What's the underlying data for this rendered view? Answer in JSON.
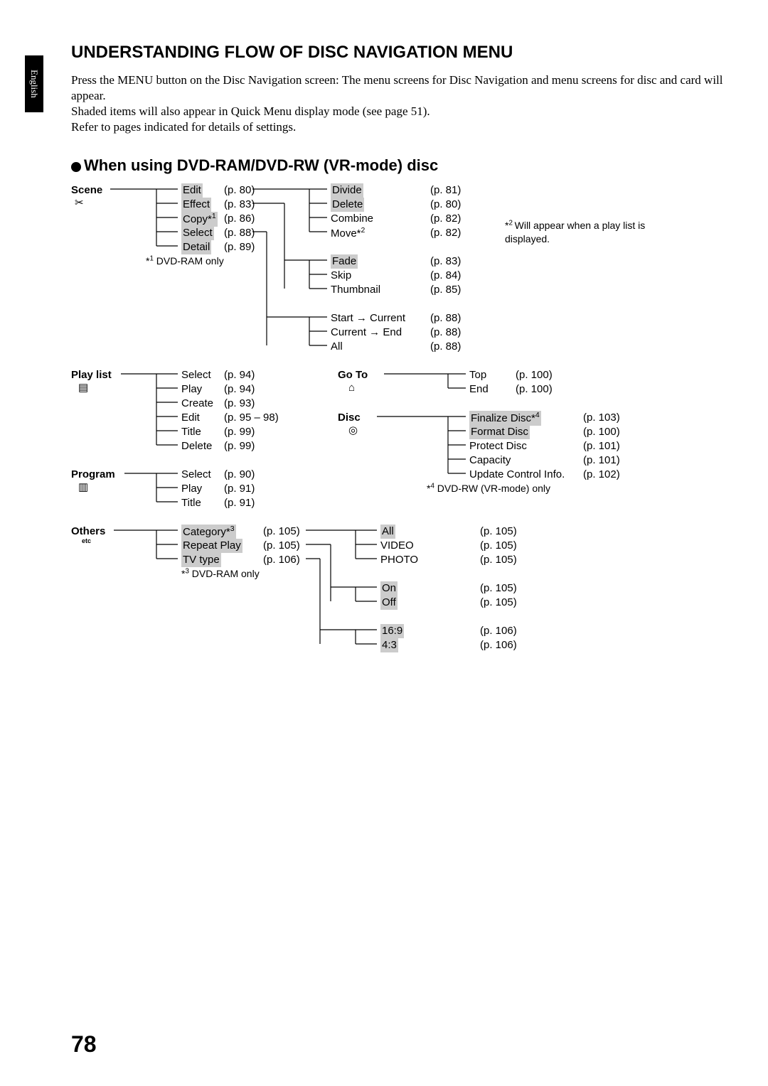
{
  "sideTab": "English",
  "title": "UNDERSTANDING FLOW OF DISC NAVIGATION MENU",
  "intro": [
    "Press the MENU button on the Disc Navigation screen: The menu screens for Disc Navigation and menu screens for disc and card will appear.",
    "Shaded items will also appear in Quick Menu display mode (see page 51).",
    "Refer to pages indicated for details of settings."
  ],
  "section_heading": "When using DVD-RAM/DVD-RW (VR-mode) disc",
  "roots": {
    "scene": "Scene",
    "playlist": "Play list",
    "program": "Program",
    "others": "Others",
    "others_sub": "etc",
    "goto": "Go To",
    "disc": "Disc"
  },
  "scene_items": [
    {
      "label": "Edit",
      "page": "(p. 80)",
      "shaded": true
    },
    {
      "label": "Effect",
      "page": "(p. 83)",
      "shaded": true
    },
    {
      "label": "Copy*1",
      "page": "(p. 86)",
      "shaded": true,
      "sup": "1"
    },
    {
      "label": "Select",
      "page": "(p. 88)",
      "shaded": true
    },
    {
      "label": "Detail",
      "page": "(p. 89)",
      "shaded": true
    }
  ],
  "scene_footnote": "*1 DVD-RAM only",
  "edit_children": [
    {
      "label": "Divide",
      "page": "(p. 81)",
      "shaded": true
    },
    {
      "label": "Delete",
      "page": "(p. 80)",
      "shaded": true
    },
    {
      "label": "Combine",
      "page": "(p. 82)"
    },
    {
      "label": "Move*2",
      "page": "(p. 82)",
      "sup": "2"
    }
  ],
  "effect_children": [
    {
      "label": "Fade",
      "page": "(p. 83)",
      "shaded": true
    },
    {
      "label": "Skip",
      "page": "(p. 84)"
    },
    {
      "label": "Thumbnail",
      "page": "(p. 85)"
    }
  ],
  "select_children": [
    {
      "label": "Start → Current",
      "page": "(p. 88)"
    },
    {
      "label": "Current → End",
      "page": "(p. 88)"
    },
    {
      "label": "All",
      "page": "(p. 88)"
    }
  ],
  "note2": [
    "*2",
    "Will appear when a play list is displayed."
  ],
  "playlist_items": [
    {
      "label": "Select",
      "page": "(p. 94)"
    },
    {
      "label": "Play",
      "page": "(p. 94)"
    },
    {
      "label": "Create",
      "page": "(p. 93)"
    },
    {
      "label": "Edit",
      "page": "(p. 95 – 98)"
    },
    {
      "label": "Title",
      "page": "(p. 99)"
    },
    {
      "label": "Delete",
      "page": "(p. 99)"
    }
  ],
  "program_items": [
    {
      "label": "Select",
      "page": "(p. 90)"
    },
    {
      "label": "Play",
      "page": "(p. 91)"
    },
    {
      "label": "Title",
      "page": "(p. 91)"
    }
  ],
  "goto_items": [
    {
      "label": "Top",
      "page": "(p. 100)"
    },
    {
      "label": "End",
      "page": "(p. 100)"
    }
  ],
  "disc_items": [
    {
      "label": "Finalize Disc*4",
      "page": "(p. 103)",
      "shaded": true,
      "sup": "4"
    },
    {
      "label": "Format Disc",
      "page": "(p. 100)",
      "shaded": true
    },
    {
      "label": "Protect Disc",
      "page": "(p. 101)"
    },
    {
      "label": "Capacity",
      "page": "(p. 101)"
    },
    {
      "label": "Update Control Info.",
      "page": "(p. 102)"
    }
  ],
  "disc_footnote": "*4 DVD-RW (VR-mode) only",
  "others_items": [
    {
      "label": "Category*3",
      "page": "(p. 105)",
      "shaded": true,
      "sup": "3"
    },
    {
      "label": "Repeat Play",
      "page": "(p. 105)",
      "shaded": true
    },
    {
      "label": "TV type",
      "page": "(p. 106)",
      "shaded": true
    }
  ],
  "others_footnote": "*3 DVD-RAM only",
  "category_children": [
    {
      "label": "All",
      "page": "(p. 105)",
      "shaded": true
    },
    {
      "label": "VIDEO",
      "page": "(p. 105)"
    },
    {
      "label": "PHOTO",
      "page": "(p. 105)"
    }
  ],
  "repeat_children": [
    {
      "label": "On",
      "page": "(p. 105)",
      "shaded": true
    },
    {
      "label": "Off",
      "page": "(p. 105)",
      "shaded": true
    }
  ],
  "tvtype_children": [
    {
      "label": "16:9",
      "page": "(p. 106)",
      "shaded": true
    },
    {
      "label": "4:3",
      "page": "(p. 106)",
      "shaded": true
    }
  ],
  "icons": {
    "scene": "✂",
    "playlist": "▤",
    "program": "▥",
    "goto": "⌂",
    "disc": "◎"
  },
  "pageNumber": "78"
}
